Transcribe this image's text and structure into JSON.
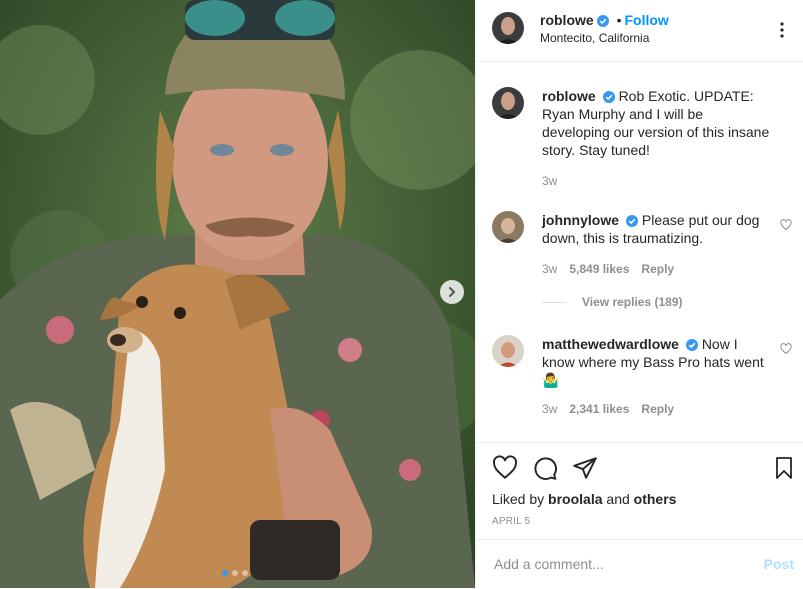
{
  "post": {
    "author": "roblowe",
    "follow_label": "Follow",
    "separator": "•",
    "location": "Montecito, California"
  },
  "comments": [
    {
      "username": "roblowe",
      "text": "Rob Exotic. UPDATE: Ryan Murphy and I will be developing our version of this insane story. Stay tuned!",
      "time": "3w"
    },
    {
      "username": "johnnylowe",
      "text": "Please put our dog down, this is traumatizing.",
      "time": "3w",
      "likes": "5,849 likes",
      "reply_label": "Reply",
      "view_replies": "View replies (189)"
    },
    {
      "username": "matthewedwardlowe",
      "text": "Now I know where my Bass Pro hats went 🤷‍♂️",
      "time": "3w",
      "likes": "2,341 likes",
      "reply_label": "Reply"
    }
  ],
  "likes": {
    "prefix": "Liked by",
    "user": "broolala",
    "joiner": "and",
    "others": "others"
  },
  "date": "APRIL 5",
  "add_comment": {
    "placeholder": "Add a comment...",
    "post_label": "Post"
  },
  "carousel": {
    "slides": 3,
    "current": 1
  },
  "colors": {
    "accent": "#0095f6",
    "verified": "#3897f0",
    "post_disabled": "#b2dffc",
    "muted": "#8e8e8e"
  },
  "icons": [
    "verified-badge-icon",
    "more-options-icon",
    "heart-icon",
    "comment-icon",
    "share-icon",
    "bookmark-icon",
    "chevron-right-icon"
  ]
}
